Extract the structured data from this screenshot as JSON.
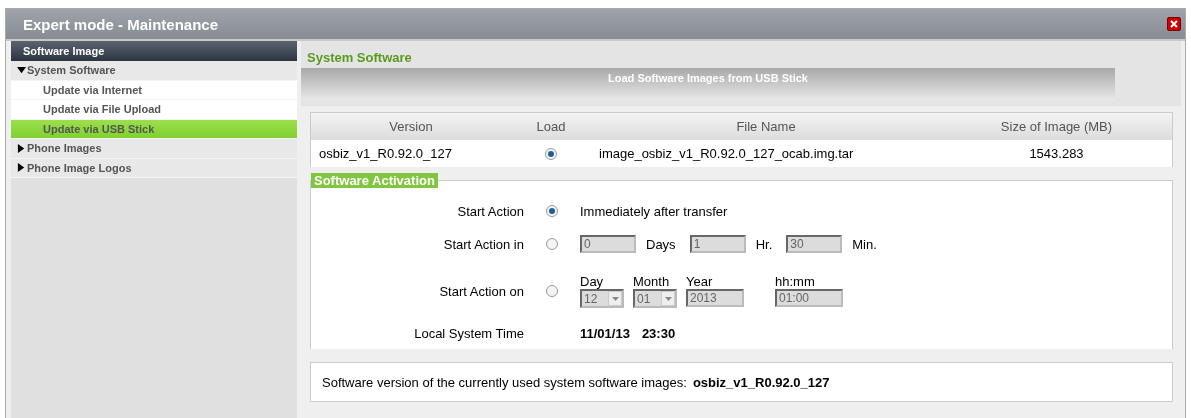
{
  "window": {
    "title": "Expert mode - Maintenance"
  },
  "sidebar": {
    "header": "Software Image",
    "items": [
      {
        "label": "System Software",
        "expanded": true,
        "selected": false,
        "children": [
          {
            "label": "Update via Internet",
            "selected": false
          },
          {
            "label": "Update via File Upload",
            "selected": false
          },
          {
            "label": "Update via USB Stick",
            "selected": true
          }
        ]
      },
      {
        "label": "Phone Images",
        "expanded": false,
        "selected": false
      },
      {
        "label": "Phone Image Logos",
        "expanded": false,
        "selected": false
      }
    ]
  },
  "main": {
    "heading": "System Software",
    "banner": "Load Software Images from USB Stick",
    "table": {
      "columns": [
        "Version",
        "Load",
        "File Name",
        "Size of Image (MB)"
      ],
      "rows": [
        {
          "version": "osbiz_v1_R0.92.0_127",
          "selected": true,
          "file_name": "image_osbiz_v1_R0.92.0_127_ocab.img.tar",
          "size": "1543.283"
        }
      ]
    },
    "activation": {
      "title": "Software Activation",
      "options": [
        {
          "kind": "text",
          "label": "Start Action",
          "selected": true,
          "text": "Immediately after transfer"
        },
        {
          "kind": "duration",
          "label": "Start Action in",
          "selected": false,
          "fields": [
            {
              "value": "0",
              "unit": "Days",
              "disabled": true
            },
            {
              "value": "1",
              "unit": "Hr.",
              "disabled": true
            },
            {
              "value": "30",
              "unit": "Min.",
              "disabled": true
            }
          ]
        },
        {
          "kind": "date",
          "label": "Start Action on",
          "selected": false,
          "fields": [
            {
              "caption": "Day",
              "value": "12",
              "kind": "select",
              "disabled": true
            },
            {
              "caption": "Month",
              "value": "01",
              "kind": "select",
              "disabled": true
            },
            {
              "caption": "Year",
              "value": "2013",
              "kind": "input",
              "disabled": true
            },
            {
              "caption": "hh:mm",
              "value": "01:00",
              "kind": "input",
              "disabled": true
            }
          ]
        }
      ],
      "local_time": {
        "label": "Local System Time",
        "date": "11/01/13",
        "time": "23:30"
      }
    },
    "current": {
      "text": "Software version of the currently used system software images:",
      "value": "osbiz_v1_R0.92.0_127"
    }
  }
}
